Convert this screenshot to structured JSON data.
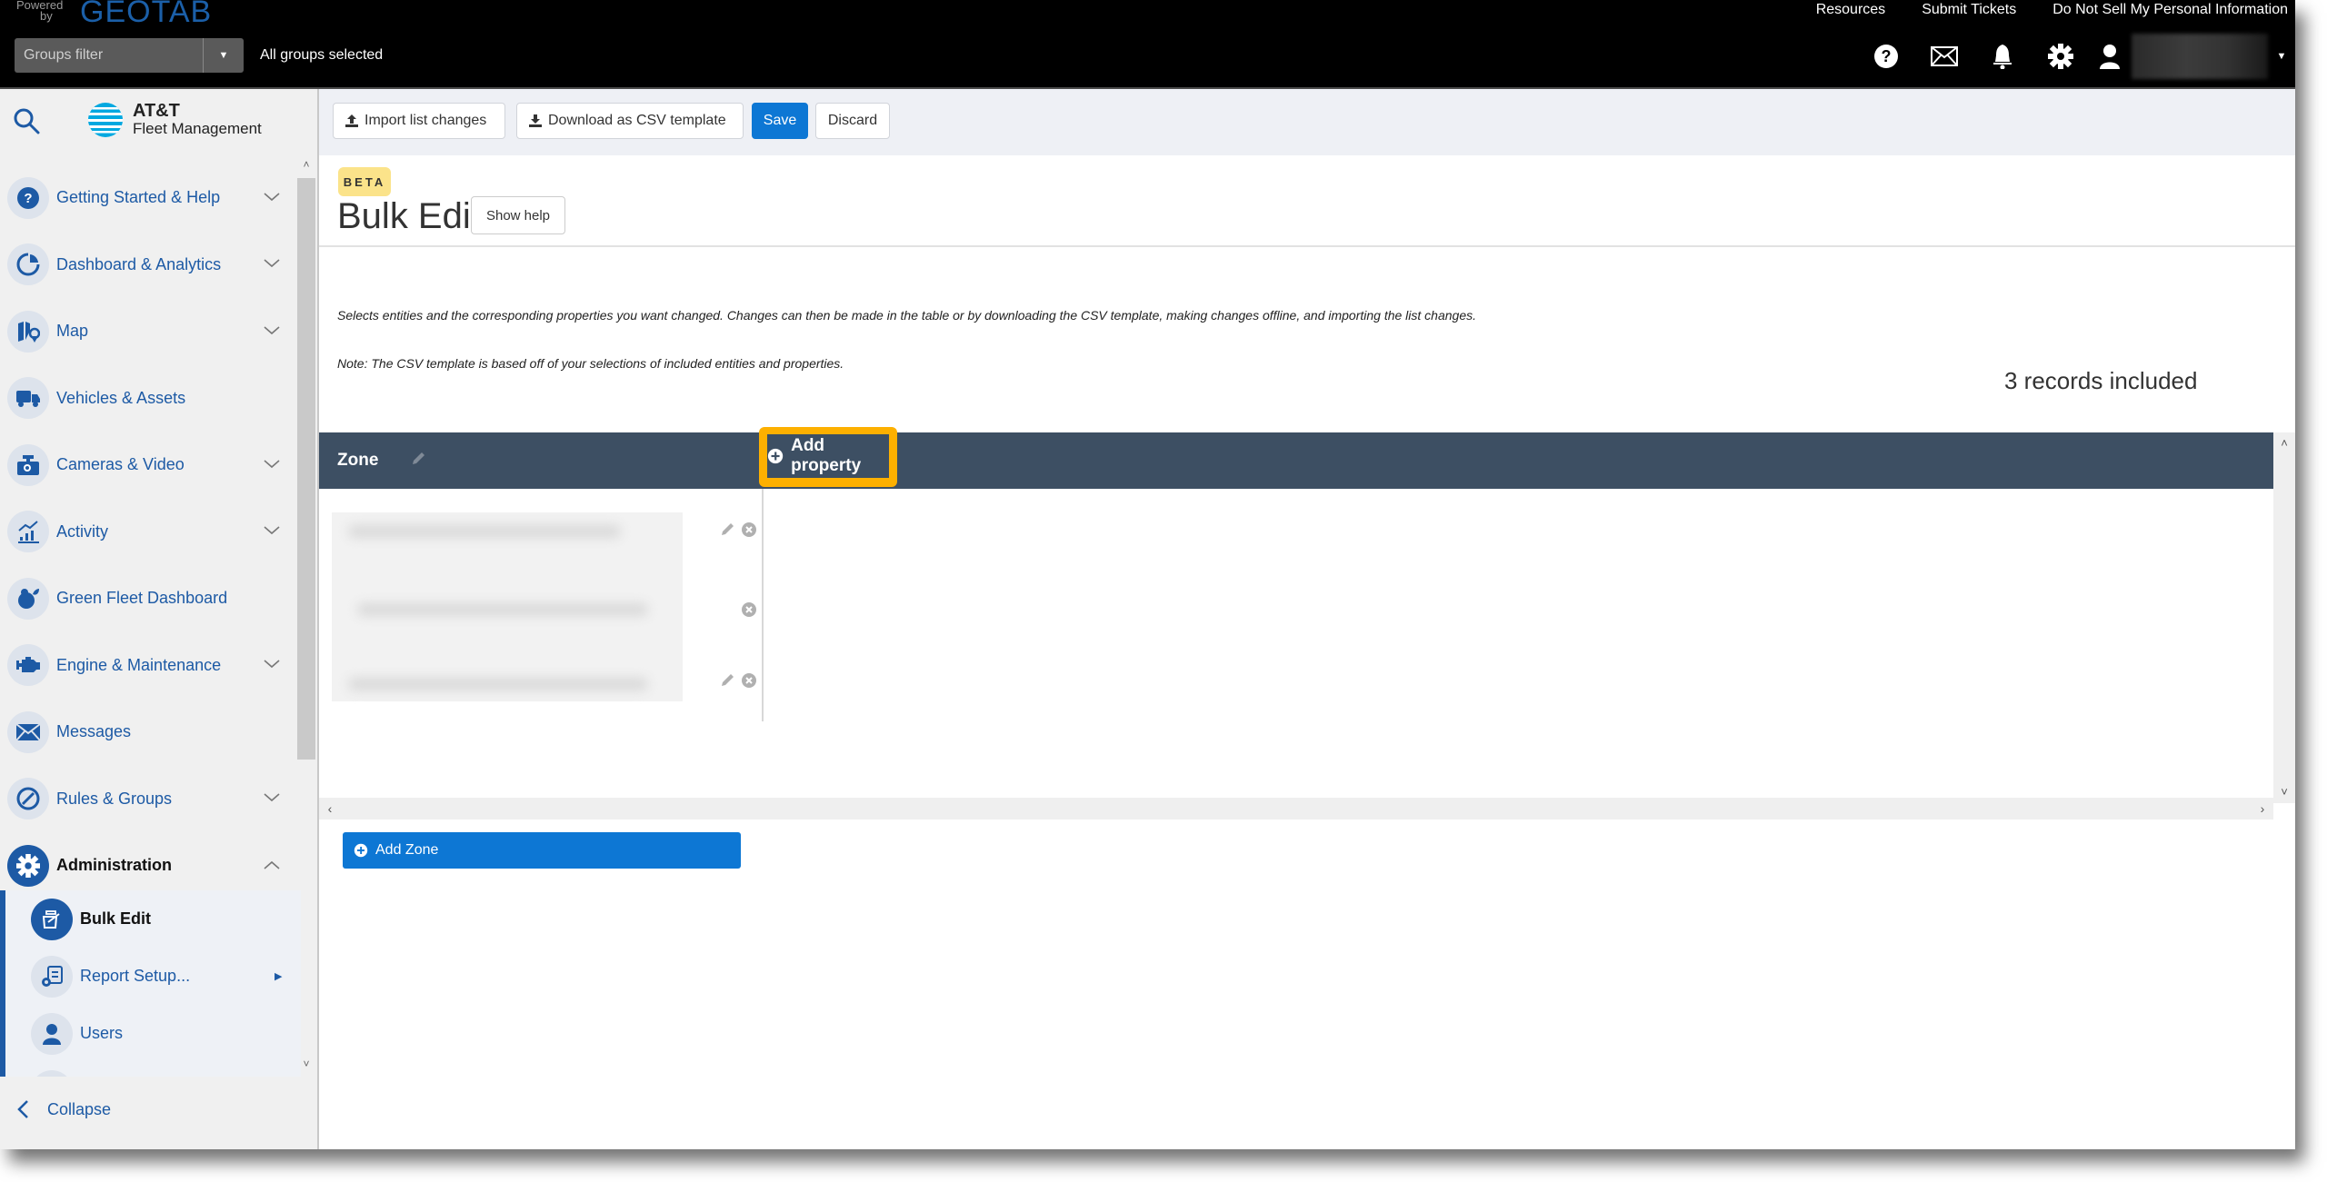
{
  "topbar": {
    "powered_by": "Powered by",
    "brand": "GEOTAB",
    "groups_filter_placeholder": "Groups filter",
    "groups_status": "All groups selected",
    "links": [
      "Resources",
      "Submit Tickets",
      "Do Not Sell My Personal Information"
    ],
    "icons": [
      "help-icon",
      "mail-icon",
      "bell-icon",
      "gear-icon",
      "user-icon"
    ]
  },
  "sidebar": {
    "brand_line1": "AT&T",
    "brand_line2": "Fleet Management",
    "items": [
      {
        "label": "Getting Started & Help",
        "icon": "help-icon",
        "expandable": true
      },
      {
        "label": "Dashboard & Analytics",
        "icon": "pie-chart-icon",
        "expandable": true
      },
      {
        "label": "Map",
        "icon": "map-icon",
        "expandable": true
      },
      {
        "label": "Vehicles & Assets",
        "icon": "truck-icon",
        "expandable": false
      },
      {
        "label": "Cameras & Video",
        "icon": "camera-icon",
        "expandable": true
      },
      {
        "label": "Activity",
        "icon": "chart-icon",
        "expandable": true
      },
      {
        "label": "Green Fleet Dashboard",
        "icon": "leaf-icon",
        "expandable": false
      },
      {
        "label": "Engine & Maintenance",
        "icon": "engine-icon",
        "expandable": true
      },
      {
        "label": "Messages",
        "icon": "mail-icon",
        "expandable": false
      },
      {
        "label": "Rules & Groups",
        "icon": "rules-icon",
        "expandable": true
      },
      {
        "label": "Administration",
        "icon": "gear-icon",
        "expandable": true,
        "expanded": true
      }
    ],
    "sub_items": [
      {
        "label": "Bulk Edit",
        "active": true
      },
      {
        "label": "Report Setup...",
        "has_submenu": true
      },
      {
        "label": "Users"
      }
    ],
    "collapse_label": "Collapse"
  },
  "toolbar": {
    "import_label": "Import list changes",
    "download_label": "Download as CSV template",
    "save_label": "Save",
    "discard_label": "Discard"
  },
  "page": {
    "badge": "BETA",
    "title": "Bulk Edit",
    "show_help_label": "Show help",
    "description": "Selects entities and the corresponding properties you want changed. Changes can then be made in the table or by downloading the CSV template, making changes offline, and importing the list changes.",
    "note": "Note: The CSV template is based off of your selections of included entities and properties.",
    "records_count": "3 records included"
  },
  "grid": {
    "column_header": "Zone",
    "add_property_label": "Add property",
    "rows": [
      {
        "value": "[redacted]",
        "editable": true
      },
      {
        "value": "[redacted]",
        "editable": false
      },
      {
        "value": "[redacted]",
        "editable": true
      }
    ],
    "add_zone_label": "Add Zone"
  },
  "colors": {
    "accent_blue": "#0d77d4",
    "nav_blue": "#1d5aa5",
    "header_slate": "#3d4f63",
    "highlight_orange": "#fdb000",
    "beta_yellow": "#fbe38a"
  }
}
